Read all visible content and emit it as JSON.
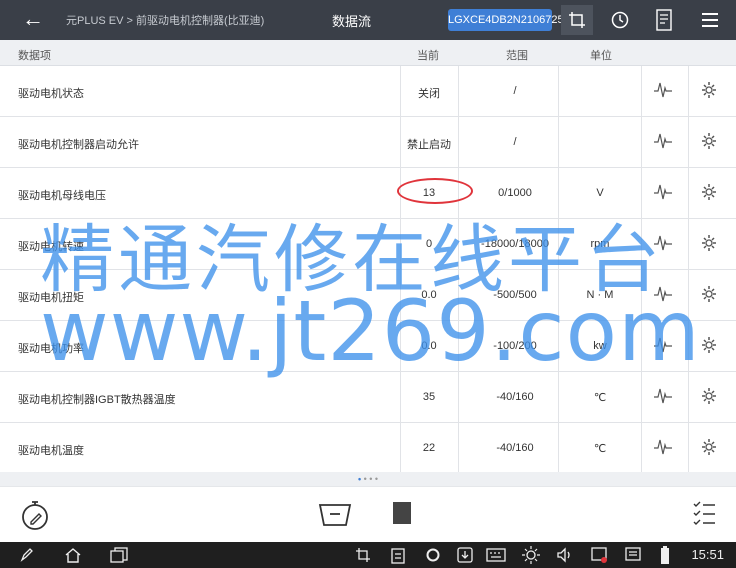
{
  "header": {
    "back_glyph": "←",
    "breadcrumb": "元PLUS EV > 前驱动电机控制器(比亚迪)",
    "title": "数据流",
    "vin": "LGXCE4DB2N2106725"
  },
  "columns": {
    "name": "数据项",
    "current": "当前",
    "range": "范围",
    "unit": "单位"
  },
  "rows": [
    {
      "name": "驱动电机状态",
      "current": "关闭",
      "range": "/",
      "unit": ""
    },
    {
      "name": "驱动电机控制器启动允许",
      "current": "禁止启动",
      "range": "/",
      "unit": ""
    },
    {
      "name": "驱动电机母线电压",
      "current": "13",
      "range": "0/1000",
      "unit": "V"
    },
    {
      "name": "驱动电机转速",
      "current": "0",
      "range": "-18000/18000",
      "unit": "rpm"
    },
    {
      "name": "驱动电机扭矩",
      "current": "0.0",
      "range": "-500/500",
      "unit": "N · M"
    },
    {
      "name": "驱动电机功率",
      "current": "0.0",
      "range": "-100/200",
      "unit": "kw"
    },
    {
      "name": "驱动电机控制器IGBT散热器温度",
      "current": "35",
      "range": "-40/160",
      "unit": "℃"
    },
    {
      "name": "驱动电机温度",
      "current": "22",
      "range": "-40/160",
      "unit": "℃"
    }
  ],
  "pager": {
    "active": "•",
    "rest": " • • •"
  },
  "watermark": {
    "line1": "精通汽修在线平台",
    "line2": "www.jt269.com"
  },
  "status": {
    "clock": "15:51"
  },
  "colors": {
    "topbar": "#3a3f48",
    "vin_badge": "#3f7fd6",
    "highlight": "#e0343b",
    "watermark": "#3e91eb"
  }
}
